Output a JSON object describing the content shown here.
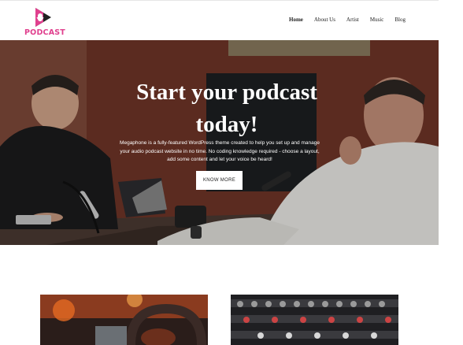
{
  "site": {
    "logo_text": "PODCAST"
  },
  "nav": {
    "items": [
      {
        "label": "Home",
        "active": true
      },
      {
        "label": "About Us",
        "active": false
      },
      {
        "label": "Artist",
        "active": false
      },
      {
        "label": "Music",
        "active": false
      },
      {
        "label": "Blog",
        "active": false
      }
    ]
  },
  "hero": {
    "title": "Start your podcast today!",
    "description": "Megaphone is a fully-featured WordPress theme created to help you set up and manage your audio podcast website in no time. No coding knowledge required - choose a layout, add some content and let your voice be heard!",
    "button_label": "KNOW MORE"
  },
  "colors": {
    "brand_pink": "#e0408e",
    "brand_dark": "#222222"
  }
}
